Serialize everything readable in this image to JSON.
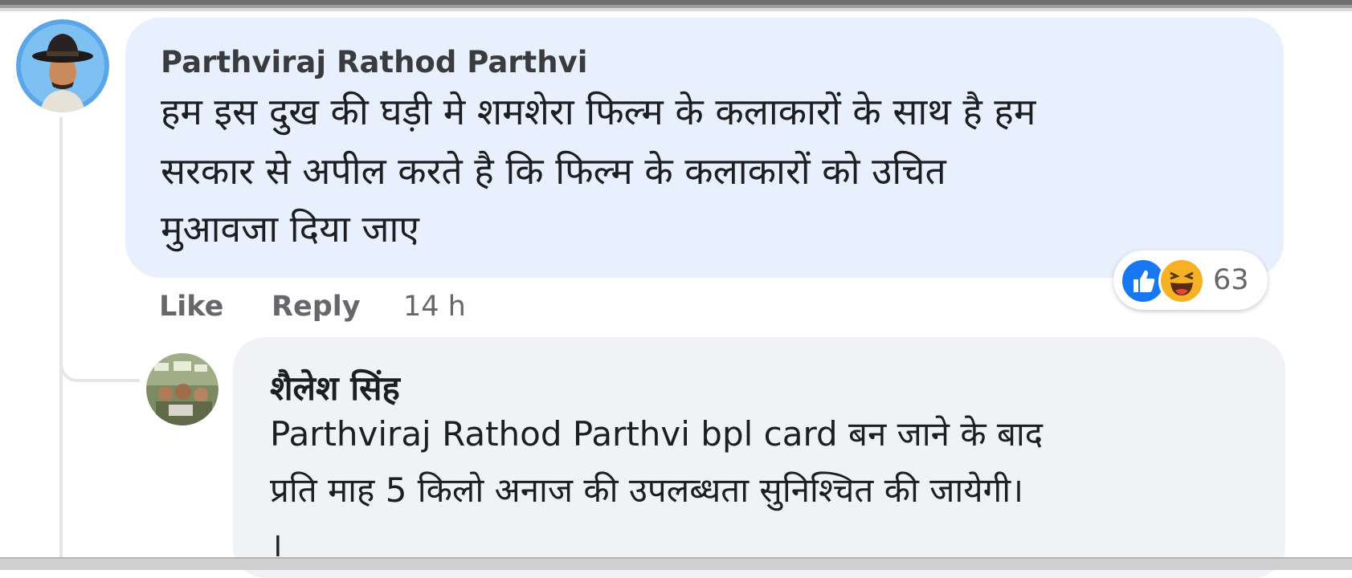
{
  "comment": {
    "author": "Parthviraj Rathod Parthvi",
    "text_lines": [
      "हम इस दुख की घड़ी मे शमशेरा फिल्म के कलाकारों के साथ है हम",
      "सरकार से अपील करते है कि फिल्म के कलाकारों को उचित",
      "मुआवजा दिया जाए"
    ],
    "actions": {
      "like_label": "Like",
      "reply_label": "Reply",
      "timestamp": "14 h"
    },
    "reactions": {
      "types": [
        "like-icon",
        "haha-icon"
      ],
      "count": "63"
    }
  },
  "reply": {
    "author": "शैलेश सिंह",
    "text_lines": [
      "Parthviraj Rathod Parthvi bpl card बन जाने के बाद",
      "प्रति माह 5 किलो अनाज की उपलब्धता सुनिश्चित की जायेगी।",
      "।"
    ]
  },
  "colors": {
    "comment_bubble": "#e7f0fc",
    "reply_bubble": "#f0f2f5",
    "like_blue": "#1877f2",
    "haha_yellow": "#f7b125",
    "meta_gray": "#65676b"
  }
}
